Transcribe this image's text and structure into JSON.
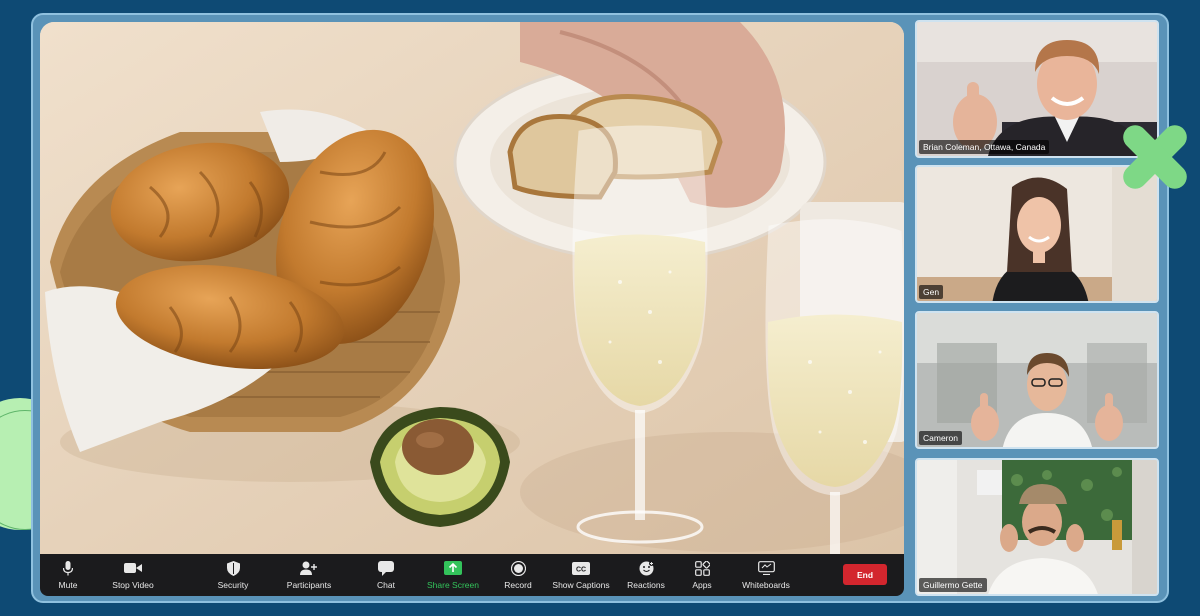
{
  "toolbar": {
    "mute": "Mute",
    "stop_video": "Stop Video",
    "security": "Security",
    "participants": "Participants",
    "chat": "Chat",
    "share_screen": "Share Screen",
    "record": "Record",
    "show_captions": "Show Captions",
    "reactions": "Reactions",
    "apps": "Apps",
    "whiteboards": "Whiteboards",
    "end": "End"
  },
  "participants": [
    {
      "name": "Brian Coleman, Ottawa, Canada"
    },
    {
      "name": "Gen"
    },
    {
      "name": "Cameron"
    },
    {
      "name": "Guillermo Gette"
    }
  ],
  "icons": {
    "mute": "microphone-icon",
    "stop_video": "video-camera-icon",
    "security": "shield-icon",
    "participants": "add-person-icon",
    "chat": "chat-bubble-icon",
    "share_screen": "share-screen-icon",
    "record": "record-icon",
    "show_captions": "cc-icon",
    "reactions": "smiley-icon",
    "apps": "apps-icon",
    "whiteboards": "whiteboard-icon"
  },
  "colors": {
    "background": "#0e4a74",
    "toolbar": "#1b1b1d",
    "share_screen_accent": "#33c35b",
    "end_button": "#d3262e"
  }
}
